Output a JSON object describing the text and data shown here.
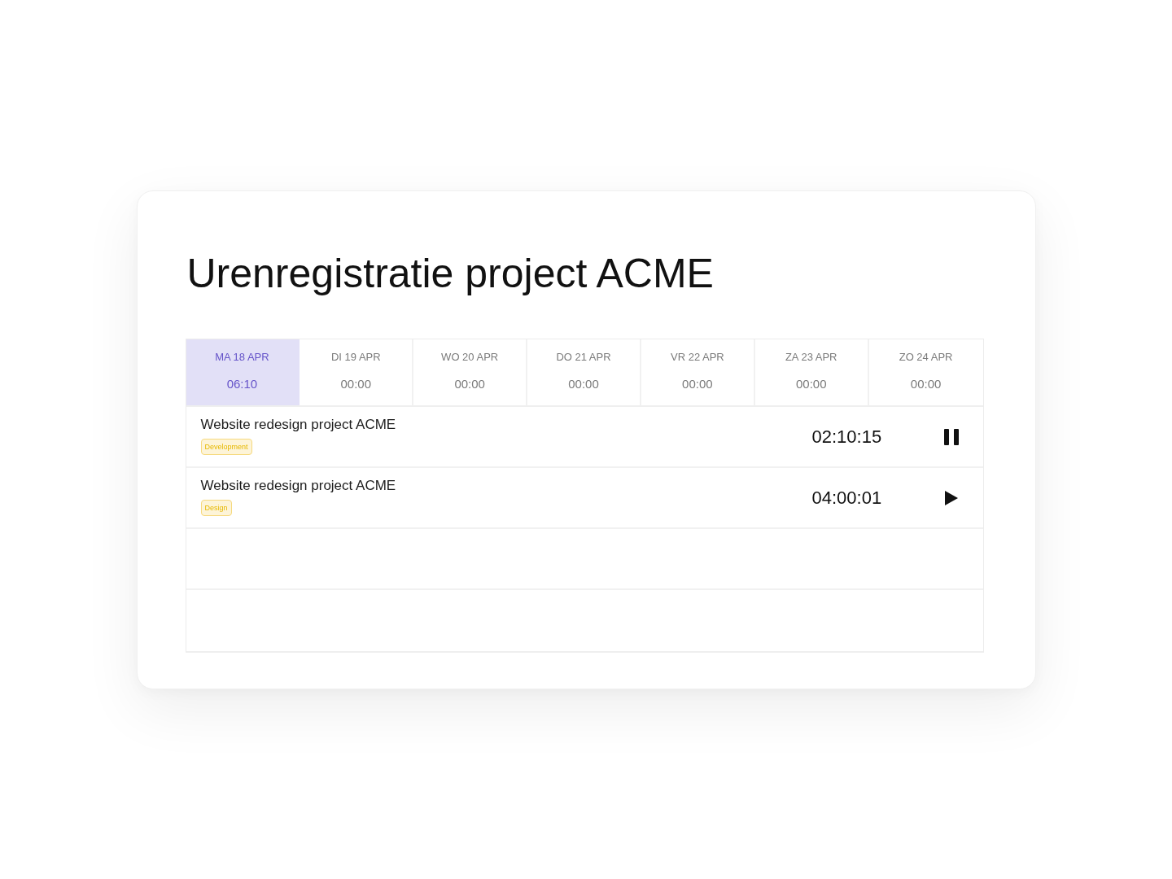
{
  "title": "Urenregistratie project ACME",
  "days": [
    {
      "label": "MA 18 APR",
      "total": "06:10",
      "selected": true
    },
    {
      "label": "DI 19 APR",
      "total": "00:00",
      "selected": false
    },
    {
      "label": "WO 20 APR",
      "total": "00:00",
      "selected": false
    },
    {
      "label": "DO 21 APR",
      "total": "00:00",
      "selected": false
    },
    {
      "label": "VR 22 APR",
      "total": "00:00",
      "selected": false
    },
    {
      "label": "ZA 23 APR",
      "total": "00:00",
      "selected": false
    },
    {
      "label": "ZO 24 APR",
      "total": "00:00",
      "selected": false
    }
  ],
  "entries": [
    {
      "title": "Website redesign project ACME",
      "tag": "Development",
      "timer": "02:10:15",
      "running": true
    },
    {
      "title": "Website redesign project ACME",
      "tag": "Design",
      "timer": "04:00:01",
      "running": false
    }
  ]
}
